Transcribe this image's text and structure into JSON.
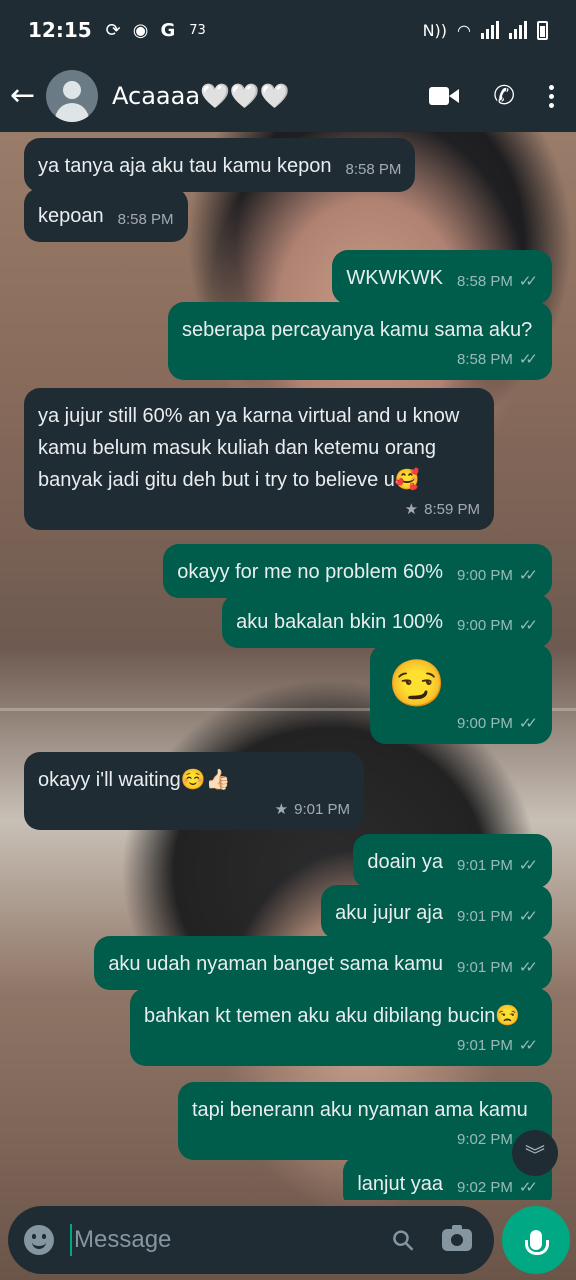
{
  "status_bar": {
    "time": "12:15",
    "notification_count": "73",
    "icons": [
      "data-saver-icon",
      "app-icon",
      "google-icon",
      "nfc-icon",
      "wifi-icon",
      "signal-icon",
      "battery-icon"
    ]
  },
  "header": {
    "contact_name": "Acaaaa🤍🤍🤍",
    "actions": [
      "video-call-icon",
      "voice-call-icon",
      "more-options-icon"
    ]
  },
  "messages": [
    {
      "dir": "in",
      "text": "ya tanya aja aku tau kamu kepon",
      "time": "8:58 PM"
    },
    {
      "dir": "in",
      "text": "kepoan",
      "time": "8:58 PM"
    },
    {
      "dir": "out",
      "text": "WKWKWK",
      "time": "8:58 PM",
      "read": true
    },
    {
      "dir": "out",
      "text": "seberapa percayanya kamu sama aku?",
      "time": "8:58 PM",
      "read": true
    },
    {
      "dir": "in",
      "text": "ya jujur still 60% an ya karna virtual and u know kamu belum masuk kuliah dan ketemu orang banyak jadi gitu deh but i try to believe u🥰",
      "time": "8:59 PM",
      "starred": true
    },
    {
      "dir": "out",
      "text": "okayy for me no problem 60%",
      "time": "9:00 PM",
      "read": true
    },
    {
      "dir": "out",
      "text": "aku bakalan bkin 100%",
      "time": "9:00 PM",
      "read": true
    },
    {
      "dir": "out",
      "text": "😏",
      "time": "9:00 PM",
      "read": true,
      "emoji_only": true
    },
    {
      "dir": "in",
      "text": "okayy i'll waiting☺️👍🏻",
      "time": "9:01 PM",
      "starred": true
    },
    {
      "dir": "out",
      "text": "doain ya",
      "time": "9:01 PM",
      "read": true
    },
    {
      "dir": "out",
      "text": "aku jujur aja",
      "time": "9:01 PM",
      "read": true
    },
    {
      "dir": "out",
      "text": "aku udah nyaman banget sama kamu",
      "time": "9:01 PM",
      "read": true
    },
    {
      "dir": "out",
      "text": "bahkan kt temen aku aku dibilang bucin😒",
      "time": "9:01 PM",
      "read": true
    },
    {
      "dir": "out",
      "text": "tapi benerann aku nyaman ama kamu",
      "time": "9:02 PM",
      "read": true
    },
    {
      "dir": "out",
      "text": "lanjut yaa",
      "time": "9:02 PM",
      "read": true
    }
  ],
  "composer": {
    "placeholder": "Message",
    "value": ""
  },
  "colors": {
    "header_bg": "#1f2c34",
    "incoming_bubble": "#202c33",
    "outgoing_bubble": "#005c4b",
    "accent": "#00a884"
  }
}
